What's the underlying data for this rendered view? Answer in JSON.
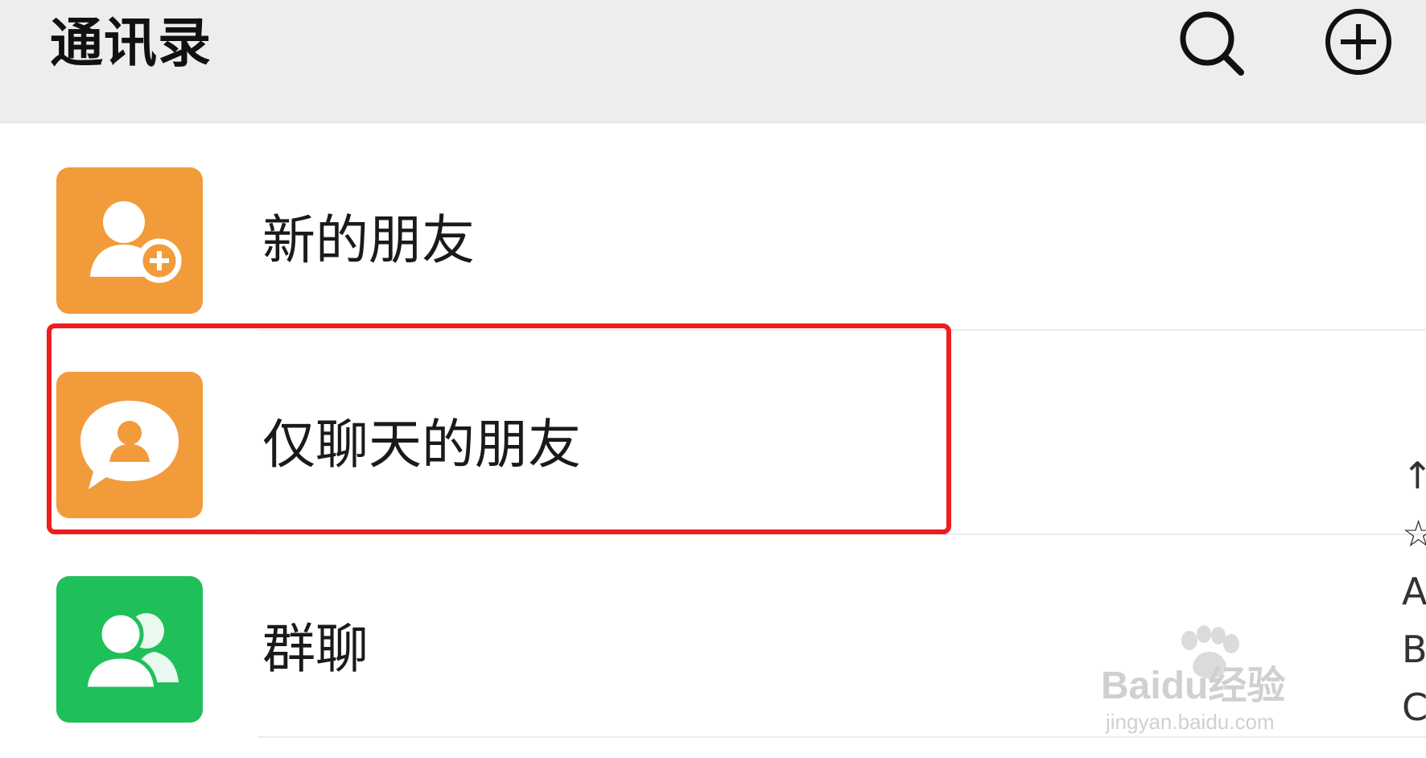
{
  "header": {
    "title": "通讯录",
    "search_icon": "search-icon",
    "add_icon": "plus-circle-icon"
  },
  "list": {
    "items": [
      {
        "label": "新的朋友",
        "icon": "add-friend-icon",
        "icon_color": "#f29b3b"
      },
      {
        "label": "仅聊天的朋友",
        "icon": "chat-only-friend-icon",
        "icon_color": "#f29b3b"
      },
      {
        "label": "群聊",
        "icon": "group-chat-icon",
        "icon_color": "#1fbf5a"
      }
    ]
  },
  "highlight": {
    "color": "#ee1e1e"
  },
  "index_bar": {
    "items": [
      "↑",
      "☆",
      "A",
      "B",
      "C"
    ]
  },
  "watermark": {
    "brand": "Baidu经验",
    "url": "jingyan.baidu.com"
  },
  "colors": {
    "header_bg": "#ededed",
    "page_bg": "#ffffff",
    "orange": "#f29b3b",
    "green": "#1fbf5a"
  }
}
